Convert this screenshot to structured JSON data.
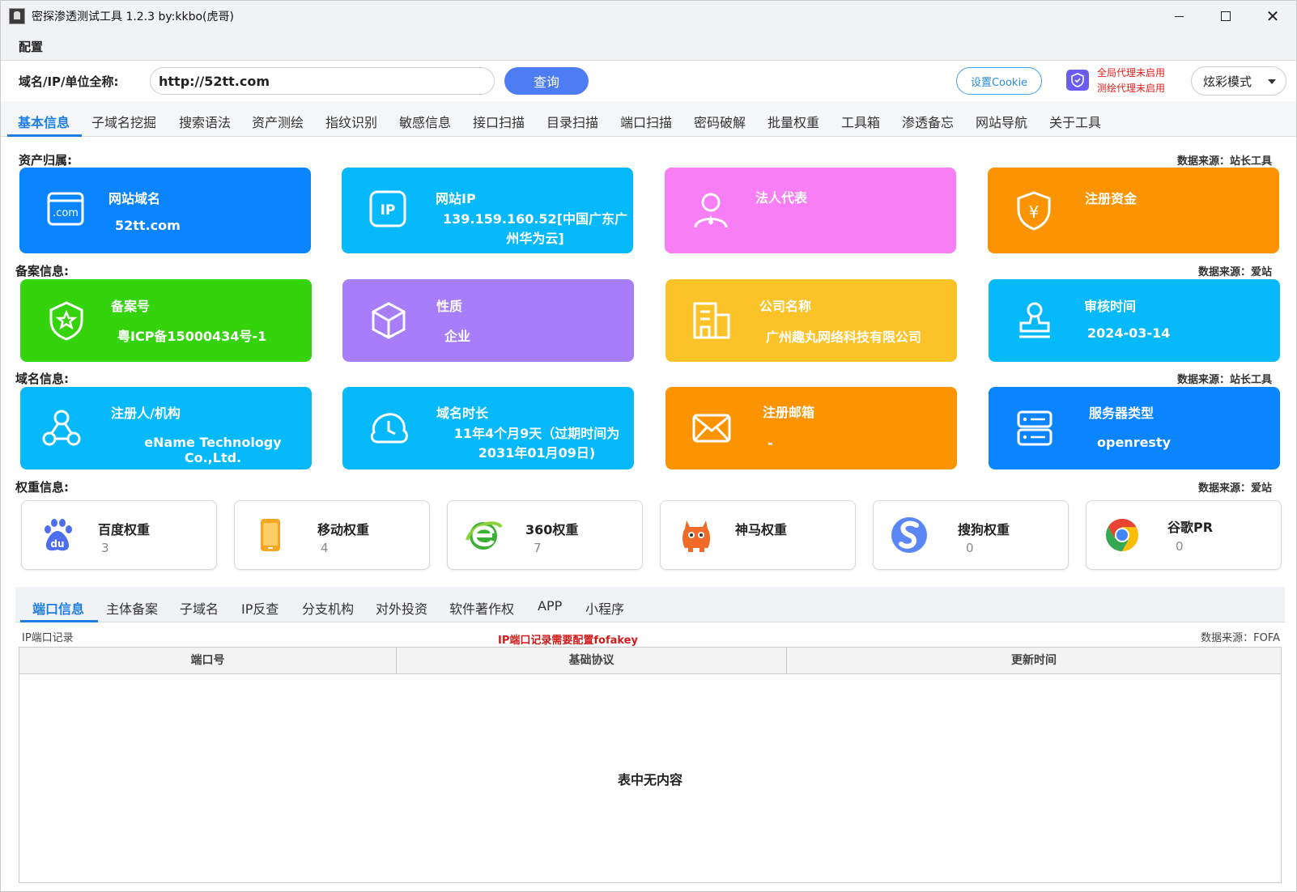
{
  "window": {
    "title": "密探渗透测试工具 1.2.3 by:kkbo(虎哥)"
  },
  "menu": {
    "config": "配置"
  },
  "search": {
    "label": "域名/IP/单位全称:",
    "value": "http://52tt.com",
    "query_label": "查询",
    "cookie_label": "设置Cookie",
    "proxy_global": "全局代理未启用",
    "proxy_mapping": "测绘代理未启用",
    "mode": "炫彩模式"
  },
  "main_tabs": [
    "基本信息",
    "子域名挖掘",
    "搜索语法",
    "资产测绘",
    "指纹识别",
    "敏感信息",
    "接口扫描",
    "目录扫描",
    "端口扫描",
    "密码破解",
    "批量权重",
    "工具箱",
    "渗透备忘",
    "网站导航",
    "关于工具"
  ],
  "sections": {
    "asset": {
      "label": "资产归属:",
      "source": "数据来源：站长工具"
    },
    "icp": {
      "label": "备案信息:",
      "source": "数据来源：爱站"
    },
    "domain": {
      "label": "域名信息:",
      "source": "数据来源：站长工具"
    },
    "weight": {
      "label": "权重信息:",
      "source": "数据来源：爱站"
    }
  },
  "asset_cards": [
    {
      "title": "网站域名",
      "value": "52tt.com",
      "color": "#0a84ff",
      "icon": "com-icon"
    },
    {
      "title": "网站IP",
      "value": "139.159.160.52[中国广东广州华为云]",
      "color": "#05b9fb",
      "icon": "ip-icon"
    },
    {
      "title": "法人代表",
      "value": "",
      "color": "#f87ef6",
      "icon": "person-icon"
    },
    {
      "title": "注册资金",
      "value": "",
      "color": "#fb9400",
      "icon": "yuan-shield-icon"
    }
  ],
  "icp_cards": [
    {
      "title": "备案号",
      "value": "粤ICP备15000434号-1",
      "color": "#34d30c",
      "icon": "shield-star-icon"
    },
    {
      "title": "性质",
      "value": "企业",
      "color": "#a77df9",
      "icon": "cube-icon"
    },
    {
      "title": "公司名称",
      "value": "广州趣丸网络科技有限公司",
      "color": "#fcc328",
      "icon": "building-icon"
    },
    {
      "title": "审核时间",
      "value": "2024-03-14",
      "color": "#05b9fb",
      "icon": "stamp-icon"
    }
  ],
  "domain_cards": [
    {
      "title": "注册人/机构",
      "value": "eName Technology Co.,Ltd.",
      "color": "#05b9fb",
      "icon": "network-icon"
    },
    {
      "title": "域名时长",
      "value": "11年4个月9天（过期时间为2031年01月09日)",
      "color": "#05b9fb",
      "icon": "clock-cloud-icon"
    },
    {
      "title": "注册邮箱",
      "value": "-",
      "color": "#fb9400",
      "icon": "mail-icon"
    },
    {
      "title": "服务器类型",
      "value": "openresty",
      "color": "#0a84ff",
      "icon": "server-icon"
    }
  ],
  "weight_cards": [
    {
      "title": "百度权重",
      "value": "3",
      "icon": "baidu-icon"
    },
    {
      "title": "移动权重",
      "value": "4",
      "icon": "mobile-icon"
    },
    {
      "title": "360权重",
      "value": "7",
      "icon": "360-icon"
    },
    {
      "title": "神马权重",
      "value": "",
      "icon": "shenma-icon"
    },
    {
      "title": "搜狗权重",
      "value": "0",
      "icon": "sogou-icon"
    },
    {
      "title": "谷歌PR",
      "value": "0",
      "icon": "chrome-icon"
    }
  ],
  "sub_tabs": [
    "端口信息",
    "主体备案",
    "子域名",
    "IP反查",
    "分支机构",
    "对外投资",
    "软件著作权",
    "APP",
    "小程序"
  ],
  "port_panel": {
    "left_label": "IP端口记录",
    "warning": "IP端口记录需要配置fofakey",
    "source": "数据来源：FOFA",
    "columns": [
      "端口号",
      "基础协议",
      "更新时间"
    ],
    "empty_text": "表中无内容"
  }
}
